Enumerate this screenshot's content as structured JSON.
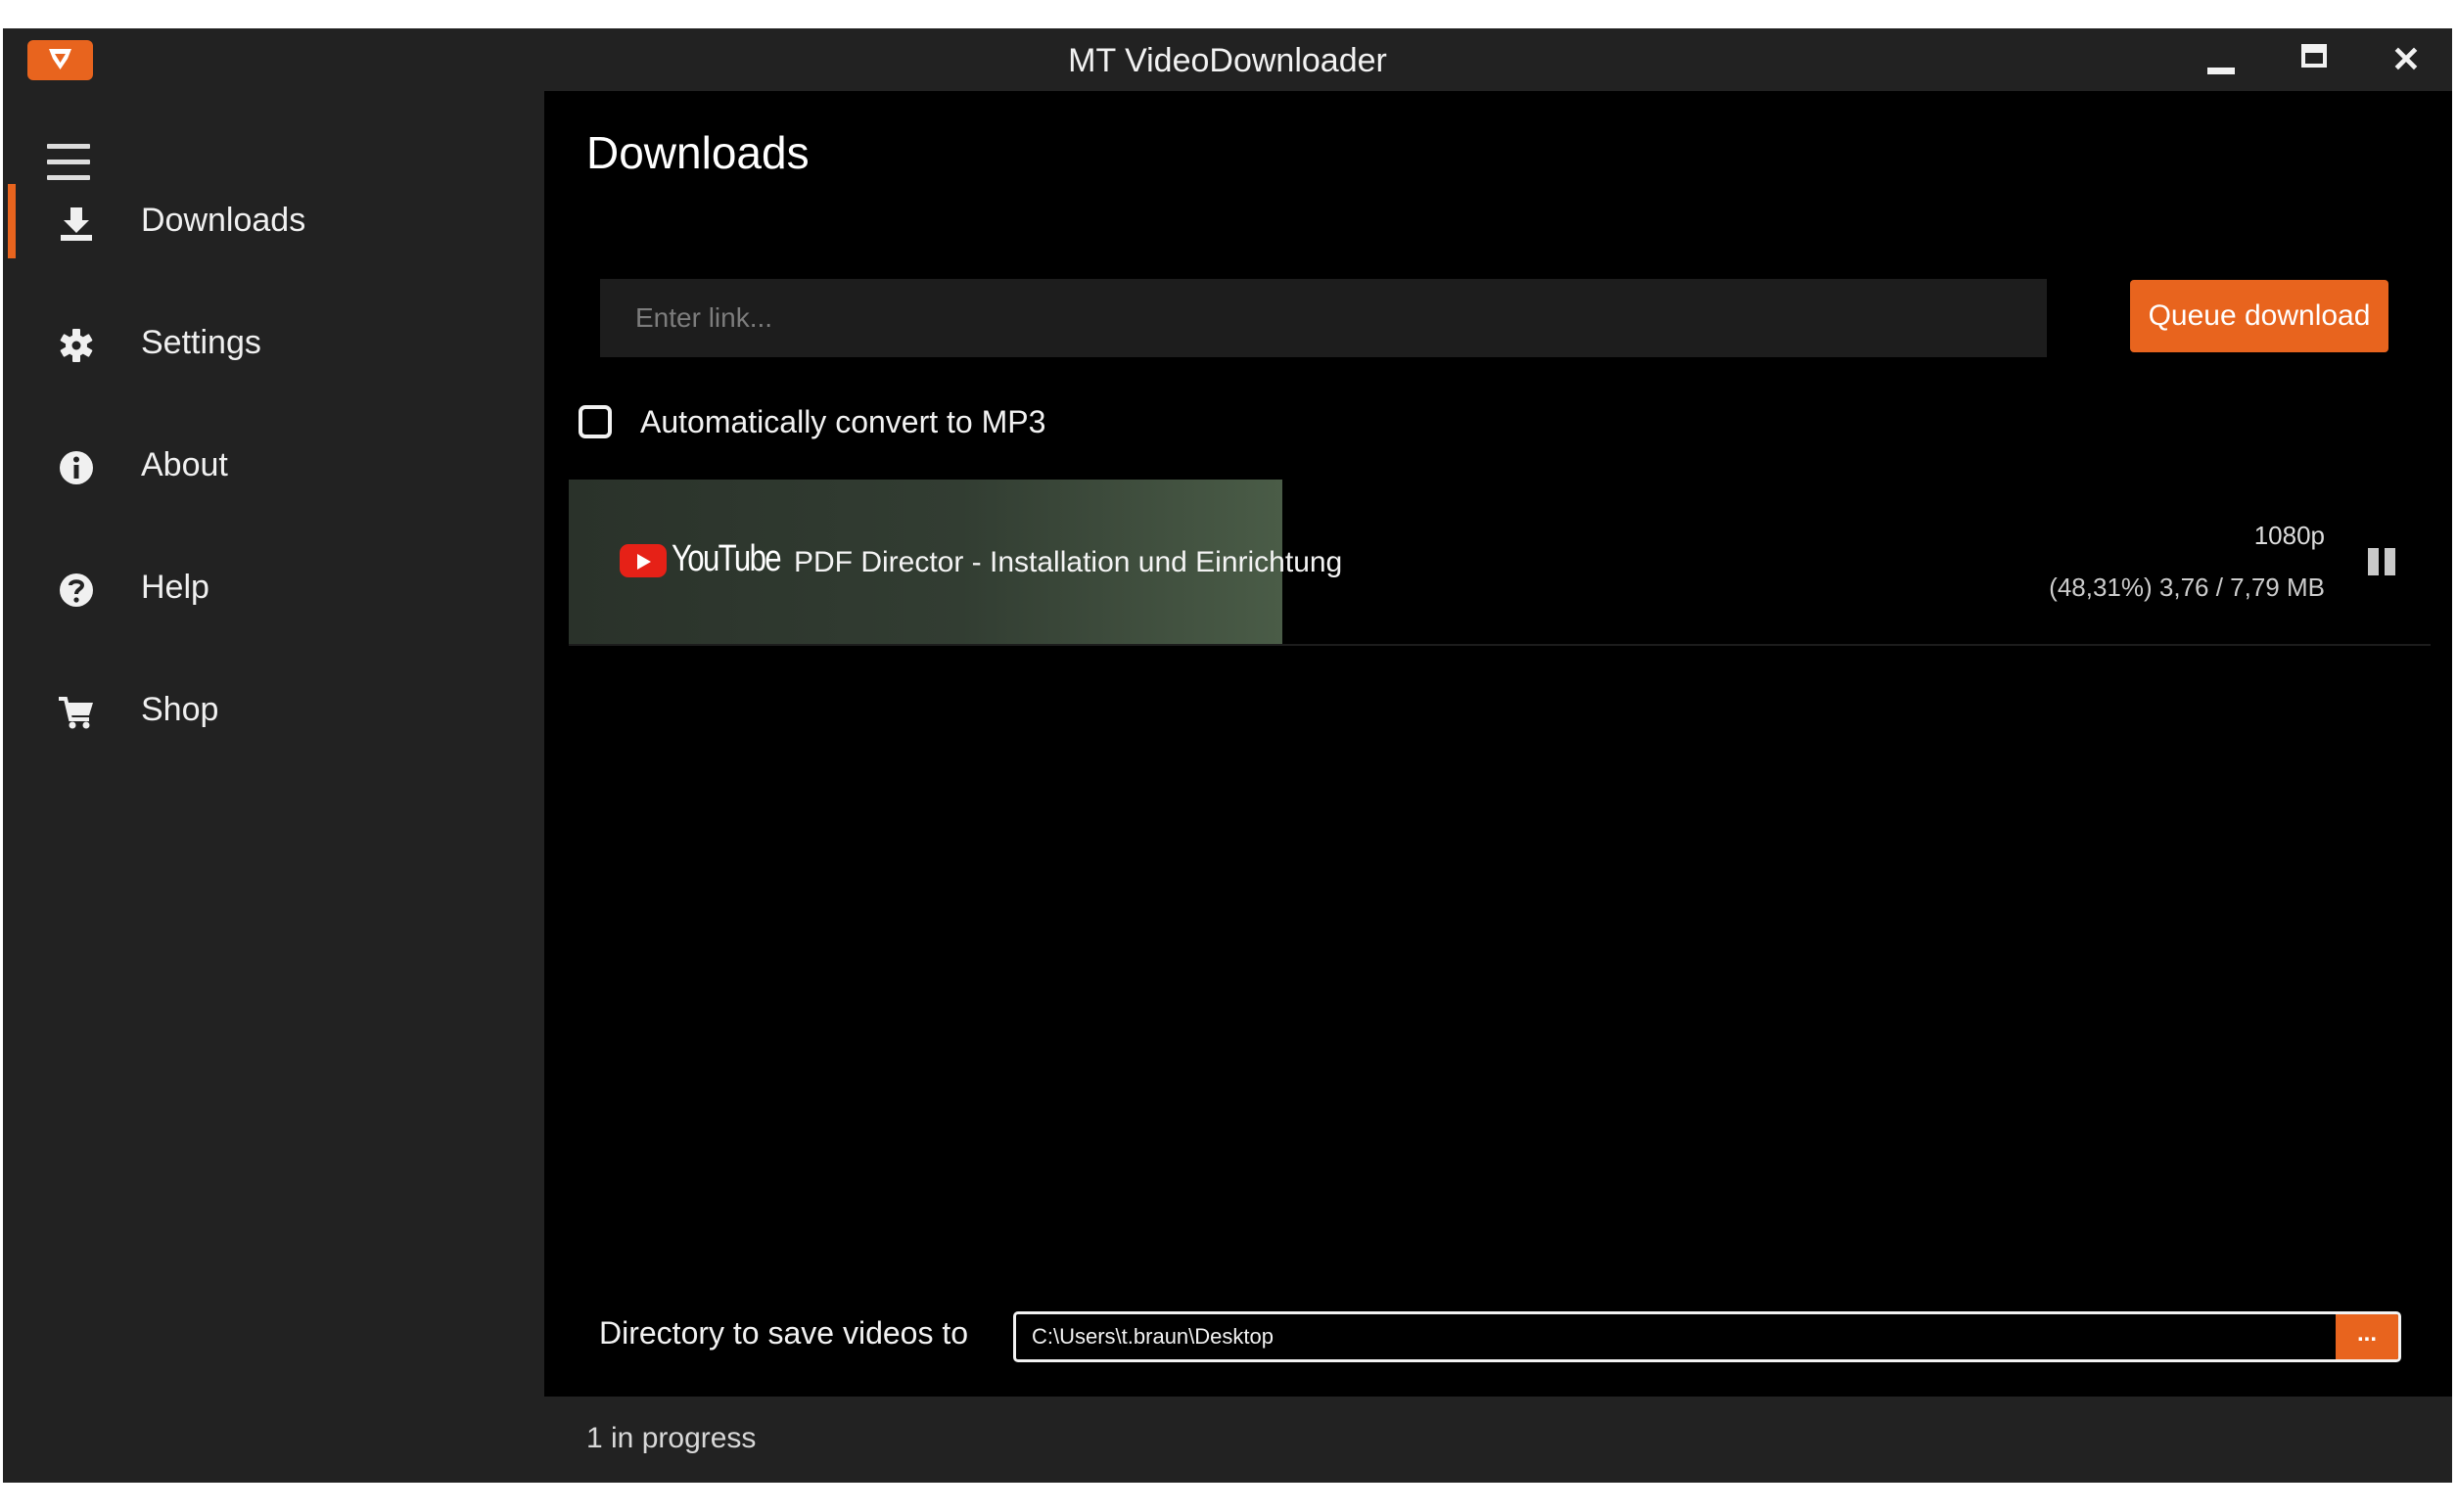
{
  "window": {
    "title": "MT VideoDownloader",
    "accent_color": "#e8641e",
    "controls": {
      "minimize_icon": "minimize-icon",
      "maximize_icon": "maximize-icon",
      "close_icon": "close-icon",
      "close_glyph": "✕"
    }
  },
  "sidebar": {
    "menu_icon": "hamburger-icon",
    "items": [
      {
        "label": "Downloads",
        "icon": "download-icon",
        "active": true
      },
      {
        "label": "Settings",
        "icon": "gear-icon",
        "active": false
      },
      {
        "label": "About",
        "icon": "info-icon",
        "active": false
      },
      {
        "label": "Help",
        "icon": "question-icon",
        "active": false
      },
      {
        "label": "Shop",
        "icon": "cart-icon",
        "active": false
      }
    ]
  },
  "main": {
    "title": "Downloads",
    "link_input": {
      "placeholder": "Enter link...",
      "value": ""
    },
    "queue_button": "Queue download",
    "convert_mp3": {
      "label": "Automatically convert to MP3",
      "checked": false
    },
    "downloads": [
      {
        "source": "YouTube",
        "title": "PDF Director - Installation und Einrichtung",
        "quality": "1080p",
        "progress_text": "(48,31%) 3,76 / 7,79 MB",
        "progress": 0.3831,
        "action_icon": "pause-icon"
      }
    ],
    "directory": {
      "label": "Directory to save videos to",
      "path": "C:\\Users\\t.braun\\Desktop",
      "browse_label": "..."
    }
  },
  "status": {
    "text": "1 in progress"
  }
}
